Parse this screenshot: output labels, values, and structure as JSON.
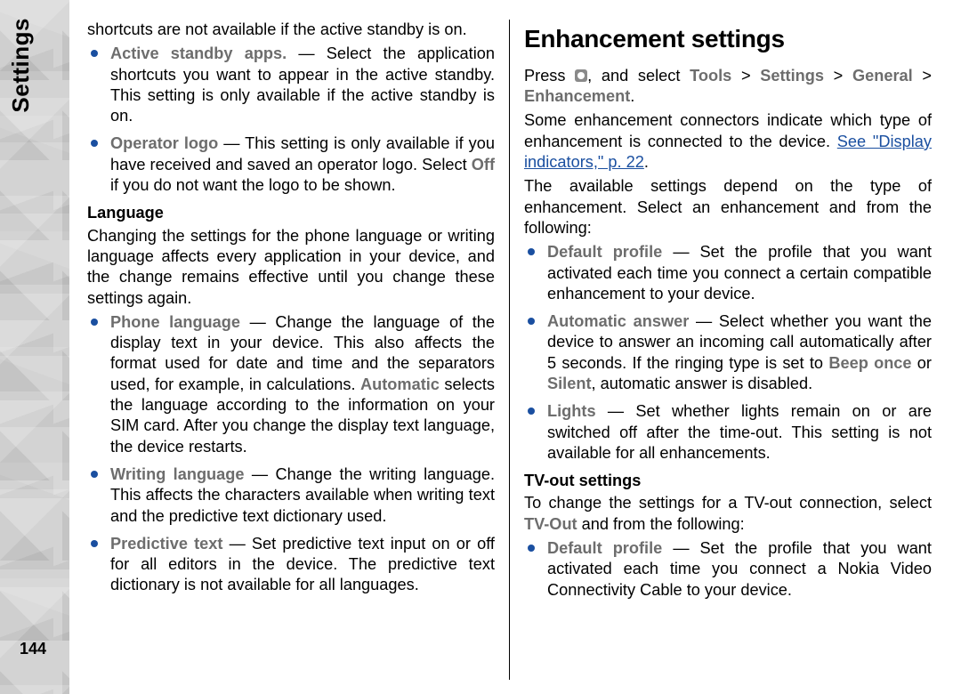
{
  "side_label": "Settings",
  "page_number": "144",
  "left": {
    "intro_cont": "shortcuts are not available if the active standby is on.",
    "bullets1": [
      {
        "label": "Active standby apps.",
        "text": " — Select the application shortcuts you want to appear in the active standby. This setting is only available if the active standby is on."
      },
      {
        "label": "Operator logo",
        "text_pre": " — This setting is only available if you have received and saved an operator logo. Select ",
        "off": "Off",
        "text_post": " if you do not want the logo to be shown."
      }
    ],
    "language_head": "Language",
    "language_para": "Changing the settings for the phone language or writing language affects every application in your device, and the change remains effective until you change these settings again.",
    "bullets2": [
      {
        "label": "Phone language",
        "text_pre": " — Change the language of the display text in your device. This also affects the format used for date and time and the separators used, for example, in calculations. ",
        "auto": "Automatic",
        "text_post": " selects the language according to the information on your SIM card. After you change the display text language, the device restarts."
      },
      {
        "label": "Writing language",
        "text": " — Change the writing language. This affects the characters available when writing text and the predictive text dictionary used."
      },
      {
        "label": "Predictive text",
        "text": " — Set predictive text input on or off for all editors in the device. The predictive text dictionary is not available for all languages."
      }
    ]
  },
  "right": {
    "heading": "Enhancement settings",
    "press_pre": "Press ",
    "press_mid": ", and select ",
    "nav": {
      "tools": "Tools",
      "settings": "Settings",
      "general": "General",
      "enhancement": "Enhancement"
    },
    "para1_pre": "Some enhancement connectors indicate which type of enhancement is connected to the device. ",
    "link": "See \"Display indicators,\" p. 22",
    "para1_post": ".",
    "para2": "The available settings depend on the type of enhancement. Select an enhancement and from the following:",
    "bullets": [
      {
        "label": "Default profile",
        "text": " — Set the profile that you want activated each time you connect a certain compatible enhancement to your device."
      },
      {
        "label": "Automatic answer",
        "text_pre": " — Select whether you want the device to answer an incoming call automatically after 5 seconds. If the ringing type is set to ",
        "beep": "Beep once",
        "or": " or ",
        "silent": "Silent",
        "text_post": ", automatic answer is disabled."
      },
      {
        "label": "Lights",
        "text": " — Set whether lights remain on or are switched off after the time-out. This setting is not available for all enhancements."
      }
    ],
    "tvout_head": "TV-out settings",
    "tvout_para_pre": "To change the settings for a TV-out connection, select ",
    "tvout_bold": "TV-Out",
    "tvout_para_post": " and from the following:",
    "tv_bullets": [
      {
        "label": "Default profile",
        "text": " — Set the profile that you want activated each time you connect a Nokia Video Connectivity Cable to your device."
      }
    ]
  }
}
